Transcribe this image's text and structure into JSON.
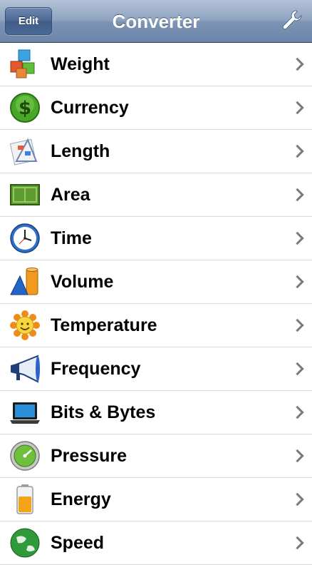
{
  "navbar": {
    "edit_label": "Edit",
    "title": "Converter",
    "settings_icon": "wrench-icon"
  },
  "categories": [
    {
      "label": "Weight",
      "icon": "cubes-icon"
    },
    {
      "label": "Currency",
      "icon": "dollar-coin-icon"
    },
    {
      "label": "Length",
      "icon": "ruler-icon"
    },
    {
      "label": "Area",
      "icon": "field-icon"
    },
    {
      "label": "Time",
      "icon": "clock-icon"
    },
    {
      "label": "Volume",
      "icon": "cone-cylinder-icon"
    },
    {
      "label": "Temperature",
      "icon": "sun-icon"
    },
    {
      "label": "Frequency",
      "icon": "megaphone-icon"
    },
    {
      "label": "Bits & Bytes",
      "icon": "laptop-icon"
    },
    {
      "label": "Pressure",
      "icon": "pressure-gauge-icon"
    },
    {
      "label": "Energy",
      "icon": "battery-icon"
    },
    {
      "label": "Speed",
      "icon": "globe-icon"
    }
  ]
}
